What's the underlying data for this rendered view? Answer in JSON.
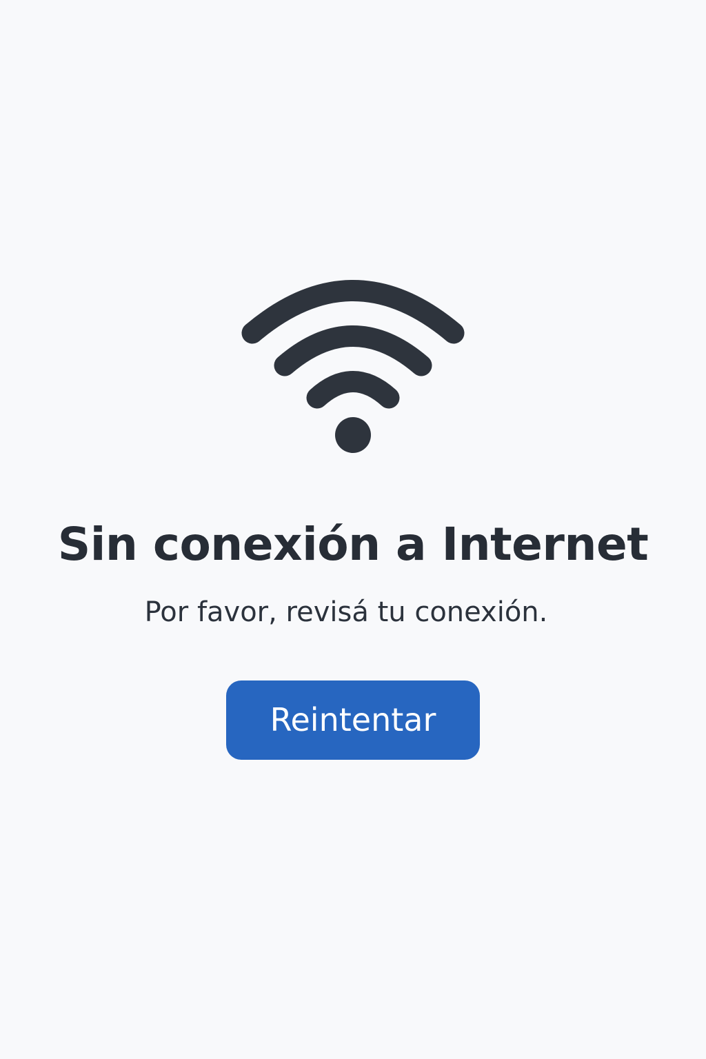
{
  "icon": {
    "name": "wifi-icon",
    "color": "#2E343D"
  },
  "message": {
    "title": "Sin conexión a Internet",
    "subtitle": "Por favor, revisá tu conexión."
  },
  "actions": {
    "retry_label": "Reintentar"
  },
  "colors": {
    "background": "#F8F9FB",
    "text": "#272D36",
    "accent": "#2766C0"
  }
}
